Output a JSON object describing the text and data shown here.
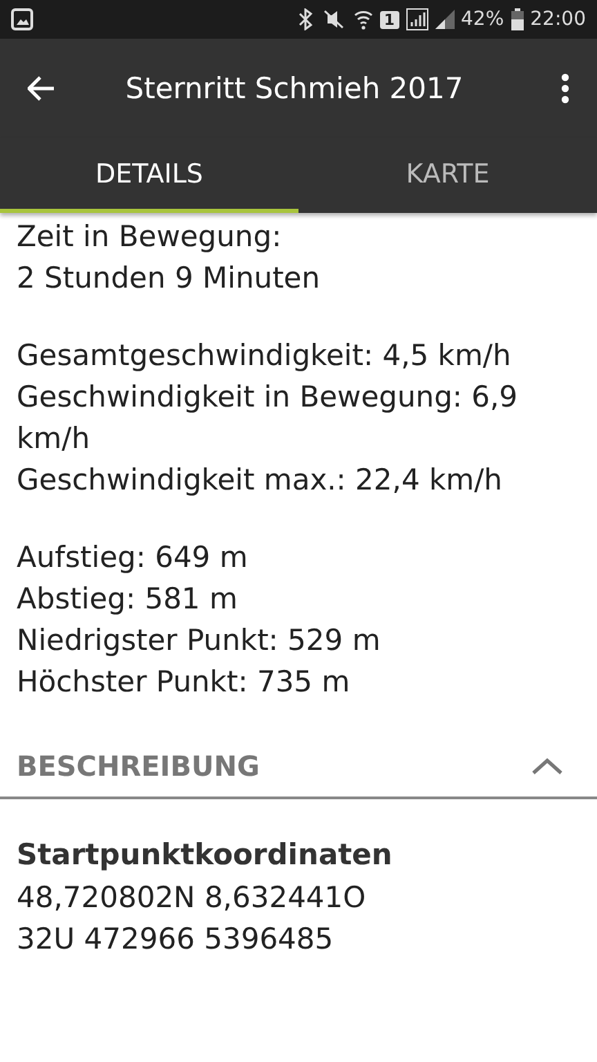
{
  "status_bar": {
    "battery": "42%",
    "time": "22:00",
    "sim": "1"
  },
  "app_bar": {
    "title": "Sternritt Schmieh 2017"
  },
  "tabs": [
    {
      "label": "DETAILS",
      "selected": true
    },
    {
      "label": "KARTE",
      "selected": false
    }
  ],
  "stat_groups": [
    [
      "Zeit in Bewegung:",
      "2 Stunden 9 Minuten"
    ],
    [
      "Gesamtgeschwindigkeit: 4,5 km/h",
      "Geschwindigkeit in Bewegung: 6,9 km/h",
      "Geschwindigkeit max.: 22,4 km/h"
    ],
    [
      "Aufstieg: 649 m",
      "Abstieg: 581 m",
      "Niedrigster Punkt: 529 m",
      "Höchster Punkt: 735 m"
    ]
  ],
  "section": {
    "title": "BESCHREIBUNG",
    "expanded": true
  },
  "coordinates": {
    "heading": "Startpunktkoordinaten",
    "lines": [
      "48,720802N 8,632441O",
      "32U 472966 5396485"
    ]
  }
}
